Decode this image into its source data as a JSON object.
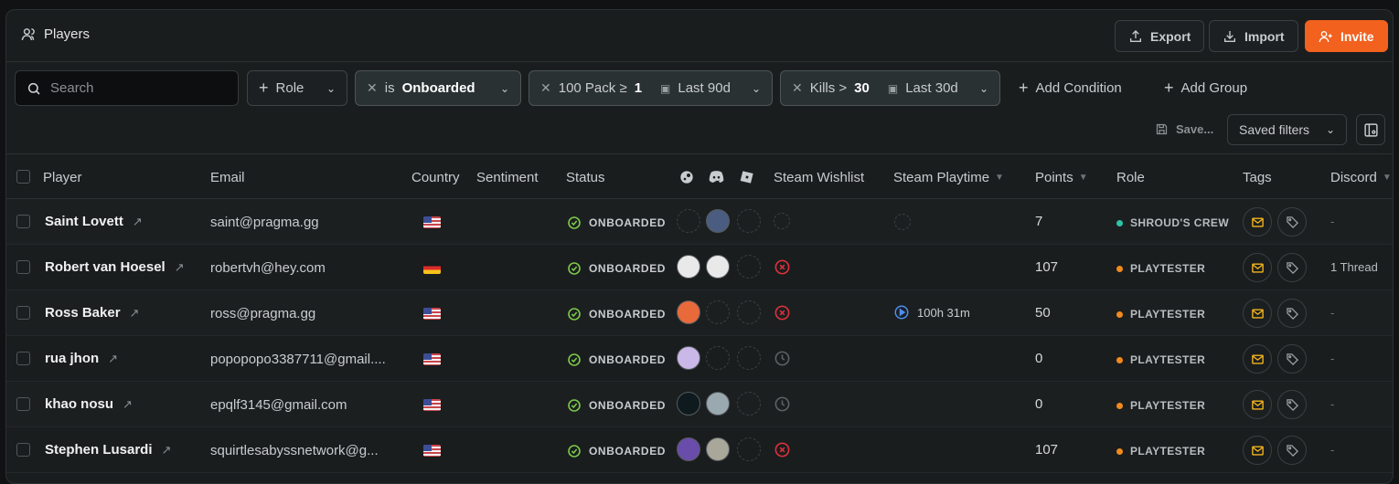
{
  "header": {
    "title": "Players",
    "export_label": "Export",
    "import_label": "Import",
    "invite_label": "Invite"
  },
  "filters": {
    "search_placeholder": "Search",
    "role_label": "Role",
    "chip1": {
      "op": "is",
      "value": "Onboarded"
    },
    "chip2": {
      "field": "100 Pack ≥",
      "value": "1",
      "range": "Last 90d"
    },
    "chip3": {
      "field": "Kills >",
      "value": "30",
      "range": "Last 30d"
    },
    "add_condition": "Add Condition",
    "add_group": "Add Group",
    "save_label": "Save...",
    "saved_filters_label": "Saved filters"
  },
  "columns": {
    "player": "Player",
    "email": "Email",
    "country": "Country",
    "sentiment": "Sentiment",
    "status": "Status",
    "steam_wishlist": "Steam Wishlist",
    "steam_playtime": "Steam Playtime",
    "points": "Points",
    "role": "Role",
    "tags": "Tags",
    "discord": "Discord"
  },
  "rows": [
    {
      "name": "Saint Lovett",
      "email": "saint@pragma.gg",
      "country": "us",
      "status": "ONBOARDED",
      "wishlist": "empty",
      "playtime": "",
      "points": "7",
      "role": "SHROUD'S CREW",
      "role_color": "#2ec4a6",
      "discord": "-"
    },
    {
      "name": "Robert van Hoesel",
      "email": "robertvh@hey.com",
      "country": "de",
      "status": "ONBOARDED",
      "wishlist": "no",
      "playtime": "",
      "points": "107",
      "role": "PLAYTESTER",
      "role_color": "#f28a1e",
      "discord": "1 Thread"
    },
    {
      "name": "Ross Baker",
      "email": "ross@pragma.gg",
      "country": "us",
      "status": "ONBOARDED",
      "wishlist": "no",
      "playtime": "100h 31m",
      "points": "50",
      "role": "PLAYTESTER",
      "role_color": "#f28a1e",
      "discord": "-"
    },
    {
      "name": "rua jhon",
      "email": "popopopo3387711@gmail....",
      "country": "us",
      "status": "ONBOARDED",
      "wishlist": "pending",
      "playtime": "",
      "points": "0",
      "role": "PLAYTESTER",
      "role_color": "#f28a1e",
      "discord": "-"
    },
    {
      "name": "khao nosu",
      "email": "epqlf3145@gmail.com",
      "country": "us",
      "status": "ONBOARDED",
      "wishlist": "pending",
      "playtime": "",
      "points": "0",
      "role": "PLAYTESTER",
      "role_color": "#f28a1e",
      "discord": "-"
    },
    {
      "name": "Stephen Lusardi",
      "email": "squirtlesabyssnetwork@g...",
      "country": "us",
      "status": "ONBOARDED",
      "wishlist": "no",
      "playtime": "",
      "points": "107",
      "role": "PLAYTESTER",
      "role_color": "#f28a1e",
      "discord": "-"
    }
  ],
  "colors": {
    "accent": "#f2611e",
    "onboarded": "#7cc84a",
    "error": "#e0323c",
    "playtime": "#4b8ef0"
  }
}
